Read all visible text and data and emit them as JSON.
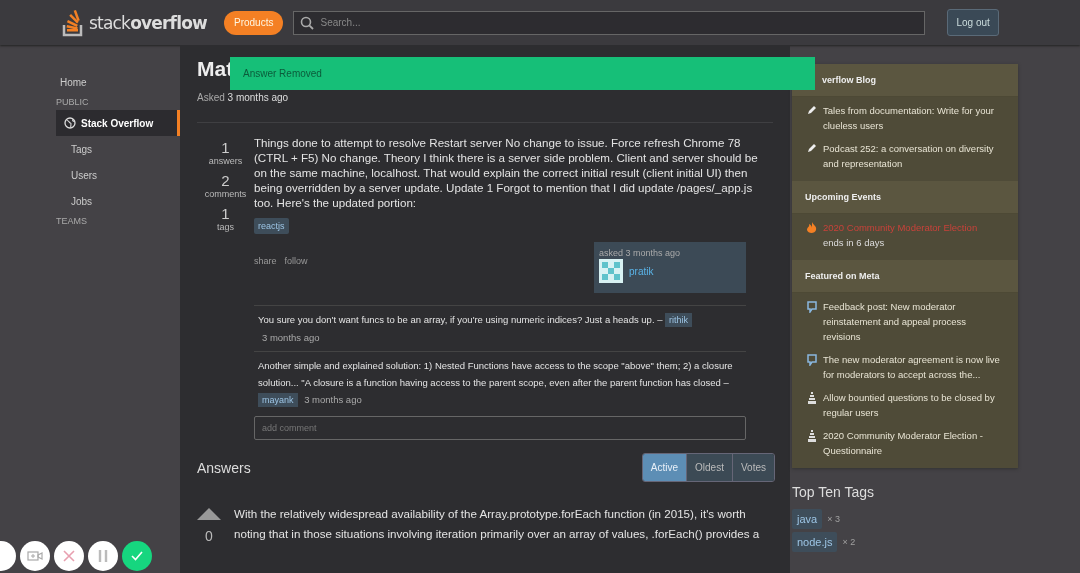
{
  "header": {
    "logo": {
      "light": "stack",
      "bold": "overflow"
    },
    "products_button": "Products",
    "search": {
      "placeholder": "Search..."
    },
    "logout_button": "Log out"
  },
  "left_nav": [
    {
      "kind": "link",
      "label": "Home",
      "selected": false
    },
    {
      "kind": "section",
      "label": "PUBLIC"
    },
    {
      "kind": "link",
      "label": "Stack Overflow",
      "selected": true
    },
    {
      "kind": "sublink",
      "label": "Tags",
      "selected": false
    },
    {
      "kind": "sublink",
      "label": "Users",
      "selected": false
    },
    {
      "kind": "sublink",
      "label": "Jobs",
      "selected": false
    },
    {
      "kind": "section",
      "label": "TEAMS"
    }
  ],
  "toast": "Answer Removed",
  "question": {
    "title": "Mat",
    "asked_label": "Asked",
    "asked_value": "3 months ago",
    "stats": [
      {
        "value": "1",
        "label": "answers"
      },
      {
        "value": "2",
        "label": "comments"
      },
      {
        "value": "1",
        "label": "tags"
      }
    ],
    "body": "Things done to attempt to resolve Restart server No change to issue. Force refresh Chrome 78 (CTRL + F5) No change. Theory I think there is a server side problem. Client and server should be on the same machine, localhost. That would explain the correct initial result (client initial UI) then being overridden by a server update. Update 1 Forgot to mention that I did update /pages/_app.js too. Here's the updated portion:",
    "tags": [
      "reactjs"
    ],
    "actions": [
      "share",
      "follow"
    ],
    "author": {
      "asked": "asked 3 months ago",
      "name": "pratik"
    },
    "comments": [
      {
        "text": "You sure you don't want funcs to be an array, if you're using numeric indices? Just a heads up. –",
        "user": "rithik",
        "time": "3 months ago"
      },
      {
        "text": "Another simple and explained solution: 1) Nested Functions have access to the scope \"above\" them; 2) a closure solution... \"A closure is a function having access to the parent scope, even after the parent function has closed –",
        "user": "mayank",
        "time": "3 months ago"
      }
    ],
    "comment_placeholder": "add comment"
  },
  "answers": {
    "heading": "Answers",
    "sort_tabs": [
      {
        "label": "Active",
        "selected": true
      },
      {
        "label": "Oldest",
        "selected": false
      },
      {
        "label": "Votes",
        "selected": false
      }
    ],
    "items": [
      {
        "votes": "0",
        "text": "With the relatively widespread availability of the Array.prototype.forEach function (in 2015), it's worth noting that in those situations involving iteration primarily over an array of values, .forEach() provides a"
      }
    ]
  },
  "widgets": [
    {
      "title": "verflow Blog",
      "items": [
        {
          "kind": "pencil",
          "text": "Tales from documentation: Write for your clueless users"
        },
        {
          "kind": "pencil",
          "text": "Podcast 252: a conversation on diversity and representation"
        }
      ]
    },
    {
      "title": "Upcoming Events",
      "items": [
        {
          "kind": "event",
          "text": "2020 Community Moderator Election",
          "sub": "ends in 6 days"
        }
      ]
    },
    {
      "title": "Featured on Meta",
      "items": [
        {
          "kind": "chat",
          "text": "Feedback post: New moderator reinstatement and appeal process revisions"
        },
        {
          "kind": "chat",
          "text": "The new moderator agreement is now live for moderators to accept across the..."
        },
        {
          "kind": "stack",
          "text": "Allow bountied questions to be closed by regular users"
        },
        {
          "kind": "stack",
          "text": "2020 Community Moderator Election - Questionnaire"
        }
      ]
    }
  ],
  "top_tags": {
    "heading": "Top Ten Tags",
    "tags": [
      {
        "name": "java",
        "count": "× 3"
      },
      {
        "name": "node.js",
        "count": "× 2"
      }
    ]
  },
  "recorder": [
    {
      "kind": "partial"
    },
    {
      "kind": "camera"
    },
    {
      "kind": "cancel"
    },
    {
      "kind": "pause"
    },
    {
      "kind": "done"
    }
  ]
}
